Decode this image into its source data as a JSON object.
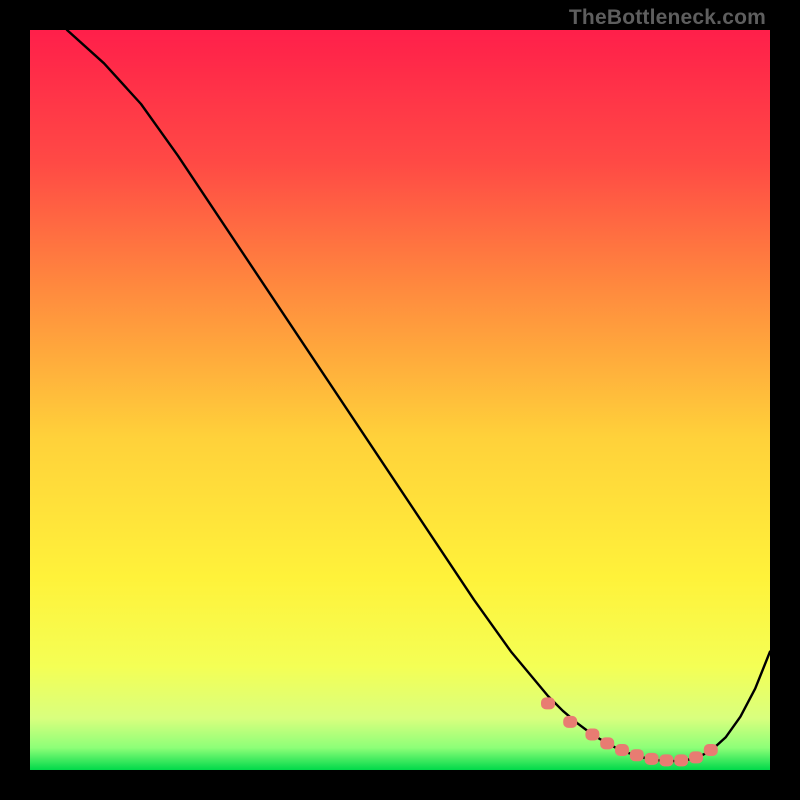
{
  "watermark": "TheBottleneck.com",
  "chart_data": {
    "type": "line",
    "title": "",
    "xlabel": "",
    "ylabel": "",
    "xlim": [
      0,
      100
    ],
    "ylim": [
      0,
      100
    ],
    "annotations": [],
    "series": [
      {
        "name": "curve",
        "x": [
          5,
          10,
          15,
          20,
          25,
          30,
          35,
          40,
          45,
          50,
          55,
          60,
          65,
          70,
          72,
          74,
          76,
          78,
          80,
          82,
          84,
          86,
          88,
          90,
          92,
          94,
          96,
          98,
          100
        ],
        "values": [
          100,
          95.5,
          90,
          83,
          75.5,
          68,
          60.5,
          53,
          45.5,
          38,
          30.5,
          23,
          16,
          10,
          8,
          6.3,
          4.8,
          3.6,
          2.6,
          1.9,
          1.4,
          1.2,
          1.2,
          1.6,
          2.6,
          4.4,
          7.2,
          11,
          16
        ]
      },
      {
        "name": "optimal-dots",
        "x": [
          70,
          73,
          76,
          78,
          80,
          82,
          84,
          86,
          88,
          90,
          92
        ],
        "values": [
          9.0,
          6.5,
          4.8,
          3.6,
          2.7,
          2.0,
          1.5,
          1.3,
          1.3,
          1.7,
          2.7
        ]
      }
    ],
    "gradient": {
      "top": "#ff1f4a",
      "mid_upper": "#ff7a42",
      "mid": "#ffd23a",
      "mid_lower": "#f7ff3a",
      "band": "#e8ff7a",
      "bottom": "#00e04a"
    }
  }
}
